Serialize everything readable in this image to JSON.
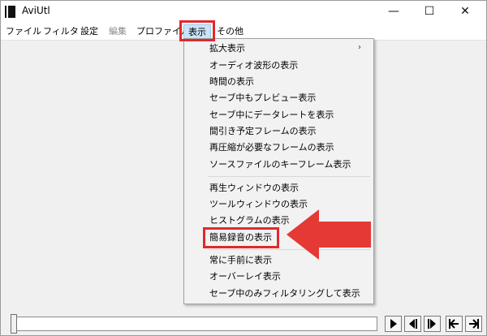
{
  "window": {
    "title": "AviUtl",
    "controls": {
      "minimize": "—",
      "maximize": "☐",
      "close": "✕"
    }
  },
  "menubar": {
    "items": [
      {
        "label": "ファイル",
        "state": "normal"
      },
      {
        "label": "フィルタ",
        "state": "normal"
      },
      {
        "label": "設定",
        "state": "normal"
      },
      {
        "label": "編集",
        "state": "disabled"
      },
      {
        "label": "プロファイル",
        "state": "normal"
      },
      {
        "label": "表示",
        "state": "active"
      },
      {
        "label": "その他",
        "state": "normal"
      }
    ]
  },
  "view_menu": {
    "items": [
      {
        "label": "拡大表示",
        "has_submenu": true
      },
      {
        "label": "オーディオ波形の表示"
      },
      {
        "label": "時間の表示"
      },
      {
        "label": "セーブ中もプレビュー表示"
      },
      {
        "label": "セーブ中にデータレートを表示"
      },
      {
        "label": "間引き予定フレームの表示"
      },
      {
        "label": "再圧縮が必要なフレームの表示"
      },
      {
        "label": "ソースファイルのキーフレーム表示"
      },
      {
        "label": "再生ウィンドウの表示"
      },
      {
        "label": "ツールウィンドウの表示"
      },
      {
        "label": "ヒストグラムの表示"
      },
      {
        "label": "簡易録音の表示",
        "highlighted": true
      },
      {
        "label": "常に手前に表示"
      },
      {
        "label": "オーバーレイ表示"
      },
      {
        "label": "セーブ中のみフィルタリングして表示"
      }
    ]
  },
  "annotations": {
    "highlight_color": "#e02a2a",
    "arrow_color": "#e53935"
  },
  "playback": {
    "buttons": [
      "play-icon",
      "prev-frame-icon",
      "next-frame-icon",
      "go-start-icon",
      "go-end-icon"
    ]
  }
}
